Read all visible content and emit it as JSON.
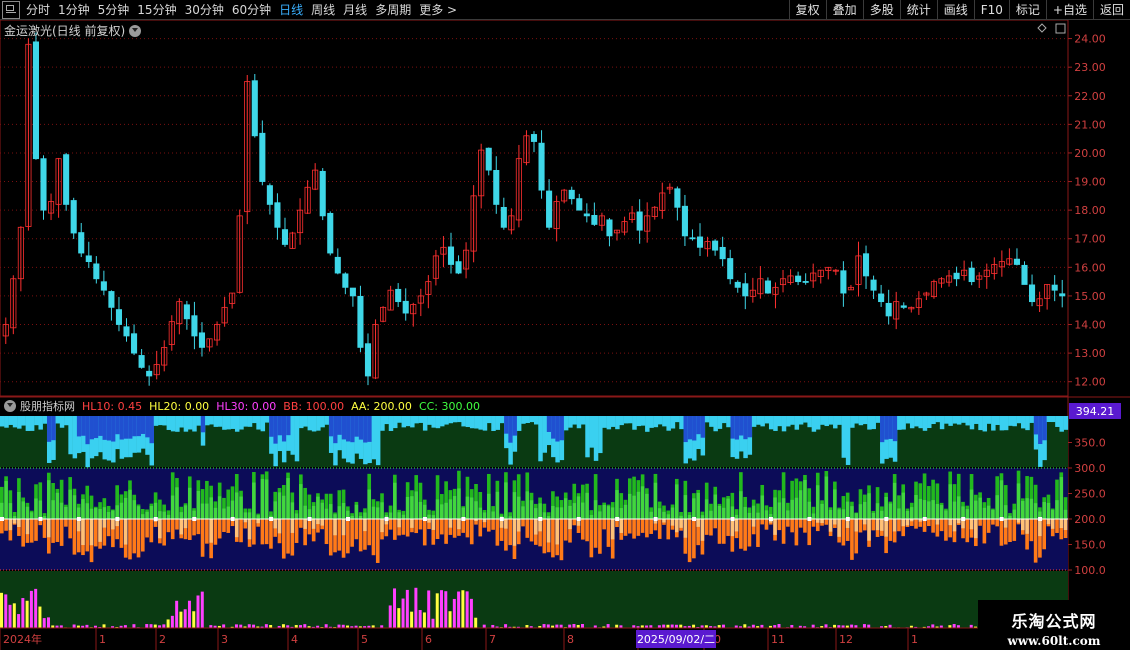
{
  "toolbar": {
    "periods": [
      "分时",
      "1分钟",
      "5分钟",
      "15分钟",
      "30分钟",
      "60分钟",
      "日线",
      "周线",
      "月线",
      "多周期",
      "更多 >"
    ],
    "active_period": "日线",
    "right_buttons": [
      "复权",
      "叠加",
      "多股",
      "统计",
      "画线",
      "F10",
      "标记",
      "+自选",
      "返回"
    ]
  },
  "price_panel": {
    "title": "金运激光(日线 前复权)",
    "right_icons": [
      "diamond-icon",
      "resize-icon"
    ]
  },
  "indicator_panel": {
    "name": "股朋指标网",
    "fields": [
      {
        "label": "HL10: 0.45",
        "color": "#ff4040"
      },
      {
        "label": "HL20: 0.00",
        "color": "#ffff40"
      },
      {
        "label": "HL30: 0.00",
        "color": "#ff40ff"
      },
      {
        "label": "BB: 100.00",
        "color": "#ff4040"
      },
      {
        "label": "AA: 200.00",
        "color": "#ffff40"
      },
      {
        "label": "CC: 300.00",
        "color": "#40ff40"
      }
    ],
    "current_value": "394.21"
  },
  "time_axis": {
    "labels": [
      "2024年",
      "1",
      "2",
      "3",
      "4",
      "5",
      "6",
      "7",
      "8",
      "9",
      "10",
      "11",
      "12",
      "1"
    ],
    "cursor_date": "2025/09/02/二"
  },
  "chart_data": [
    {
      "type": "candlestick",
      "name": "price",
      "y_ticks": [
        "24.00",
        "23.00",
        "22.00",
        "21.00",
        "20.00",
        "19.00",
        "18.00",
        "17.00",
        "16.00",
        "15.00",
        "14.00",
        "13.00",
        "12.00"
      ],
      "ylim": [
        11.5,
        24.3
      ],
      "close": [
        14.0,
        15.6,
        17.4,
        23.8,
        19.8,
        18.0,
        18.3,
        19.8,
        18.2,
        17.2,
        16.5,
        16.2,
        15.6,
        15.2,
        14.6,
        14.0,
        13.6,
        13.0,
        12.5,
        12.2,
        12.6,
        13.2,
        14.1,
        14.8,
        14.2,
        13.6,
        13.2,
        13.5,
        14.0,
        14.6,
        15.1,
        17.8,
        22.5,
        20.6,
        19.0,
        18.2,
        17.4,
        16.8,
        17.2,
        18.0,
        18.8,
        19.4,
        17.8,
        16.5,
        15.8,
        15.3,
        15.0,
        13.2,
        12.2,
        14.0,
        14.6,
        15.2,
        14.8,
        14.4,
        14.7,
        15.0,
        15.5,
        16.4,
        16.7,
        16.1,
        15.8,
        16.6,
        18.5,
        20.1,
        19.4,
        18.2,
        17.4,
        17.8,
        19.8,
        20.6,
        20.4,
        18.7,
        17.4,
        18.3,
        18.7,
        18.4,
        18.0,
        17.8,
        17.5,
        17.8,
        17.1,
        17.3,
        17.6,
        17.9,
        17.3,
        17.8,
        18.1,
        18.6,
        18.8,
        18.1,
        17.1,
        17.0,
        16.7,
        16.9,
        16.6,
        16.3,
        15.6,
        15.3,
        15.0,
        15.2,
        15.6,
        15.1,
        15.3,
        15.6,
        15.7,
        15.5,
        15.5,
        15.8,
        15.9,
        16.0,
        15.9,
        15.1,
        15.3,
        16.4,
        15.7,
        15.2,
        14.8,
        14.3,
        14.8,
        14.6,
        14.6,
        14.9,
        15.1,
        15.5,
        15.6,
        15.7,
        15.6,
        15.9,
        15.5,
        15.7,
        15.9,
        16.1,
        16.2,
        16.3,
        16.1,
        15.4,
        14.8,
        14.9,
        15.4,
        15.2,
        15.0
      ],
      "up_color": "#ff3030",
      "down_color": "#3fd7e8"
    },
    {
      "type": "bar",
      "name": "indicator",
      "y_ticks": [
        "350.0",
        "300.0",
        "250.0",
        "200.0",
        "150.0",
        "100.0"
      ],
      "reference_lines": {
        "BB": 100.0,
        "AA": 200.0,
        "CC": 300.0
      },
      "ylim": [
        85,
        400
      ],
      "series_colors": {
        "top_band": "#3ad0f0",
        "deep_top": "#2050d0",
        "upper": "#22b81e",
        "upper_light": "#5cf05a",
        "lower": "#ff7a18",
        "lower_light": "#ffe0a0",
        "volume_red": "#ff40ff",
        "volume_yellow": "#ffff40"
      }
    }
  ]
}
